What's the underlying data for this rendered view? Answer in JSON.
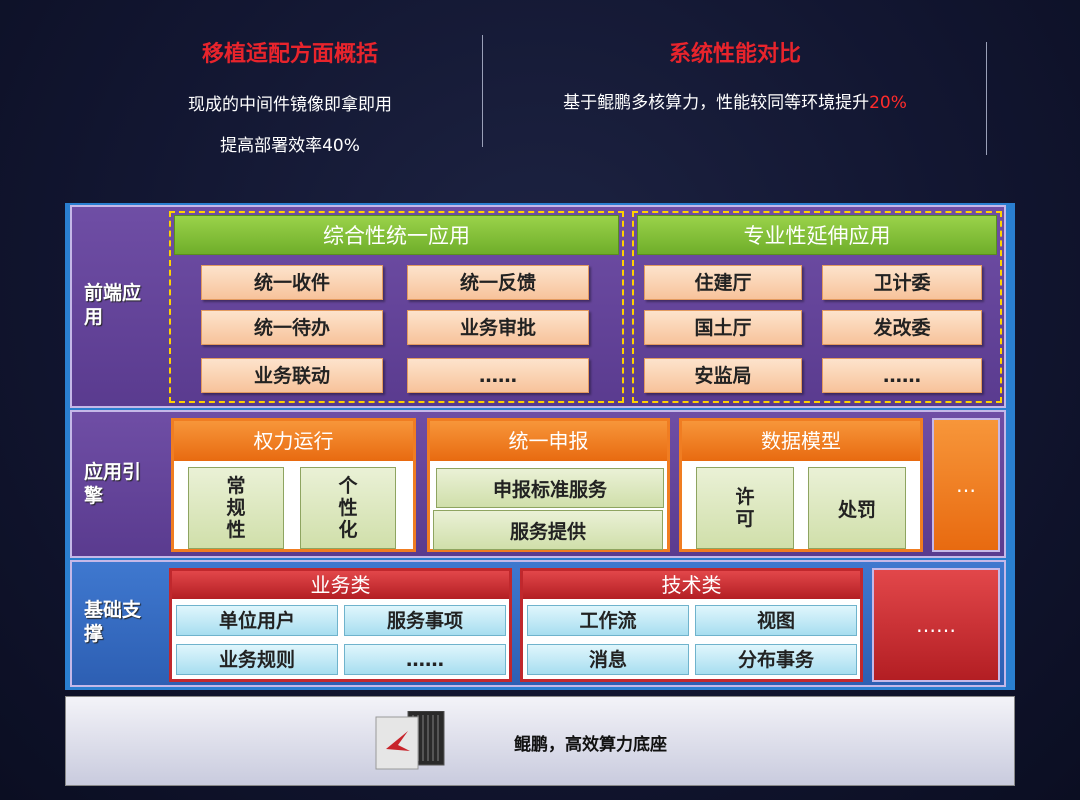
{
  "top": {
    "left": {
      "title": "移植适配方面概括",
      "line1": "现成的中间件镜像即拿即用",
      "line2": "提高部署效率40%"
    },
    "right": {
      "title": "系统性能对比",
      "line1_prefix": "基于鲲鹏多核算力，性能较同等环境提升",
      "line1_highlight": "20%"
    }
  },
  "diagram": {
    "frontend": {
      "label": "前端应用",
      "general": {
        "title": "综合性统一应用",
        "items": [
          "统一收件",
          "统一反馈",
          "统一待办",
          "业务审批",
          "业务联动",
          "……"
        ]
      },
      "specialized": {
        "title": "专业性延伸应用",
        "items": [
          "住建厅",
          "卫计委",
          "国土厅",
          "发改委",
          "安监局",
          "……"
        ]
      }
    },
    "engine": {
      "label": "应用引擎",
      "power": {
        "title": "权力运行",
        "items": [
          "常规性",
          "个性化"
        ]
      },
      "report": {
        "title": "统一申报",
        "items": [
          "申报标准服务",
          "服务提供"
        ]
      },
      "model": {
        "title": "数据模型",
        "items": [
          "许可",
          "处罚"
        ]
      },
      "more": "…"
    },
    "base": {
      "label": "基础支撑",
      "business": {
        "title": "业务类",
        "items": [
          "单位用户",
          "服务事项",
          "业务规则",
          "……"
        ]
      },
      "technical": {
        "title": "技术类",
        "items": [
          "工作流",
          "视图",
          "消息",
          "分布事务"
        ]
      },
      "more": "……"
    }
  },
  "footer": {
    "text": "鲲鹏，高效算力底座",
    "chip_icon": "kunpeng-chip-icon"
  },
  "colors": {
    "title_red": "#e8242c",
    "purple_band": "#5a3b8f",
    "blue_band": "#2d5fb3",
    "green_header": "#7fc036",
    "orange_header": "#f07d22",
    "red_header": "#c0282d"
  }
}
